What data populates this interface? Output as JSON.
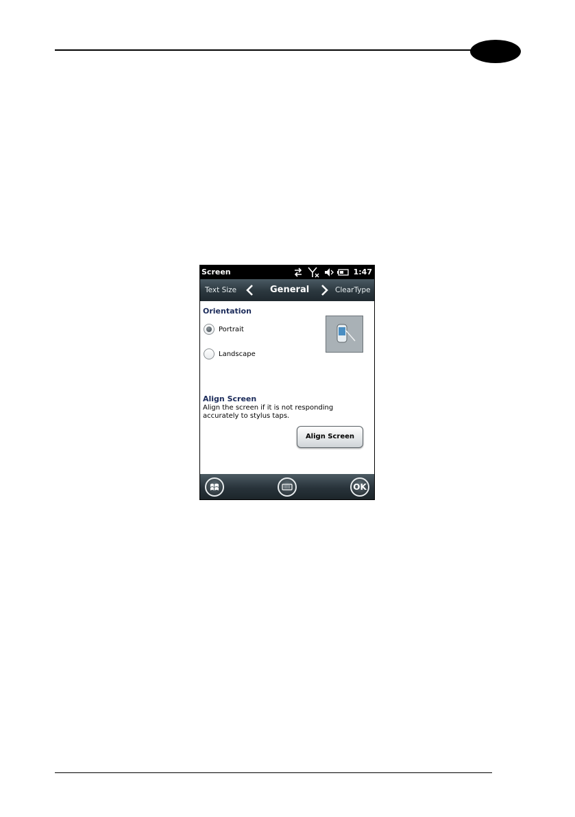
{
  "device": {
    "status_bar": {
      "title": "Screen",
      "time": "1:47",
      "icons": [
        "sync-arrows-icon",
        "no-signal-icon",
        "speaker-muted-icon",
        "battery-icon"
      ]
    },
    "nav": {
      "prev_label": "Text Size",
      "current_label": "General",
      "next_label": "ClearType"
    },
    "orientation": {
      "title": "Orientation",
      "options": [
        {
          "label": "Portrait",
          "selected": true
        },
        {
          "label": "Landscape",
          "selected": false
        }
      ],
      "preview_icon": "device-stylus-icon"
    },
    "align": {
      "title": "Align Screen",
      "description": "Align the screen if it is not responding accurately to stylus taps.",
      "button_label": "Align Screen"
    },
    "softkeys": {
      "start_icon": "windows-start-icon",
      "keyboard_icon": "keyboard-icon",
      "ok_label": "OK"
    }
  }
}
